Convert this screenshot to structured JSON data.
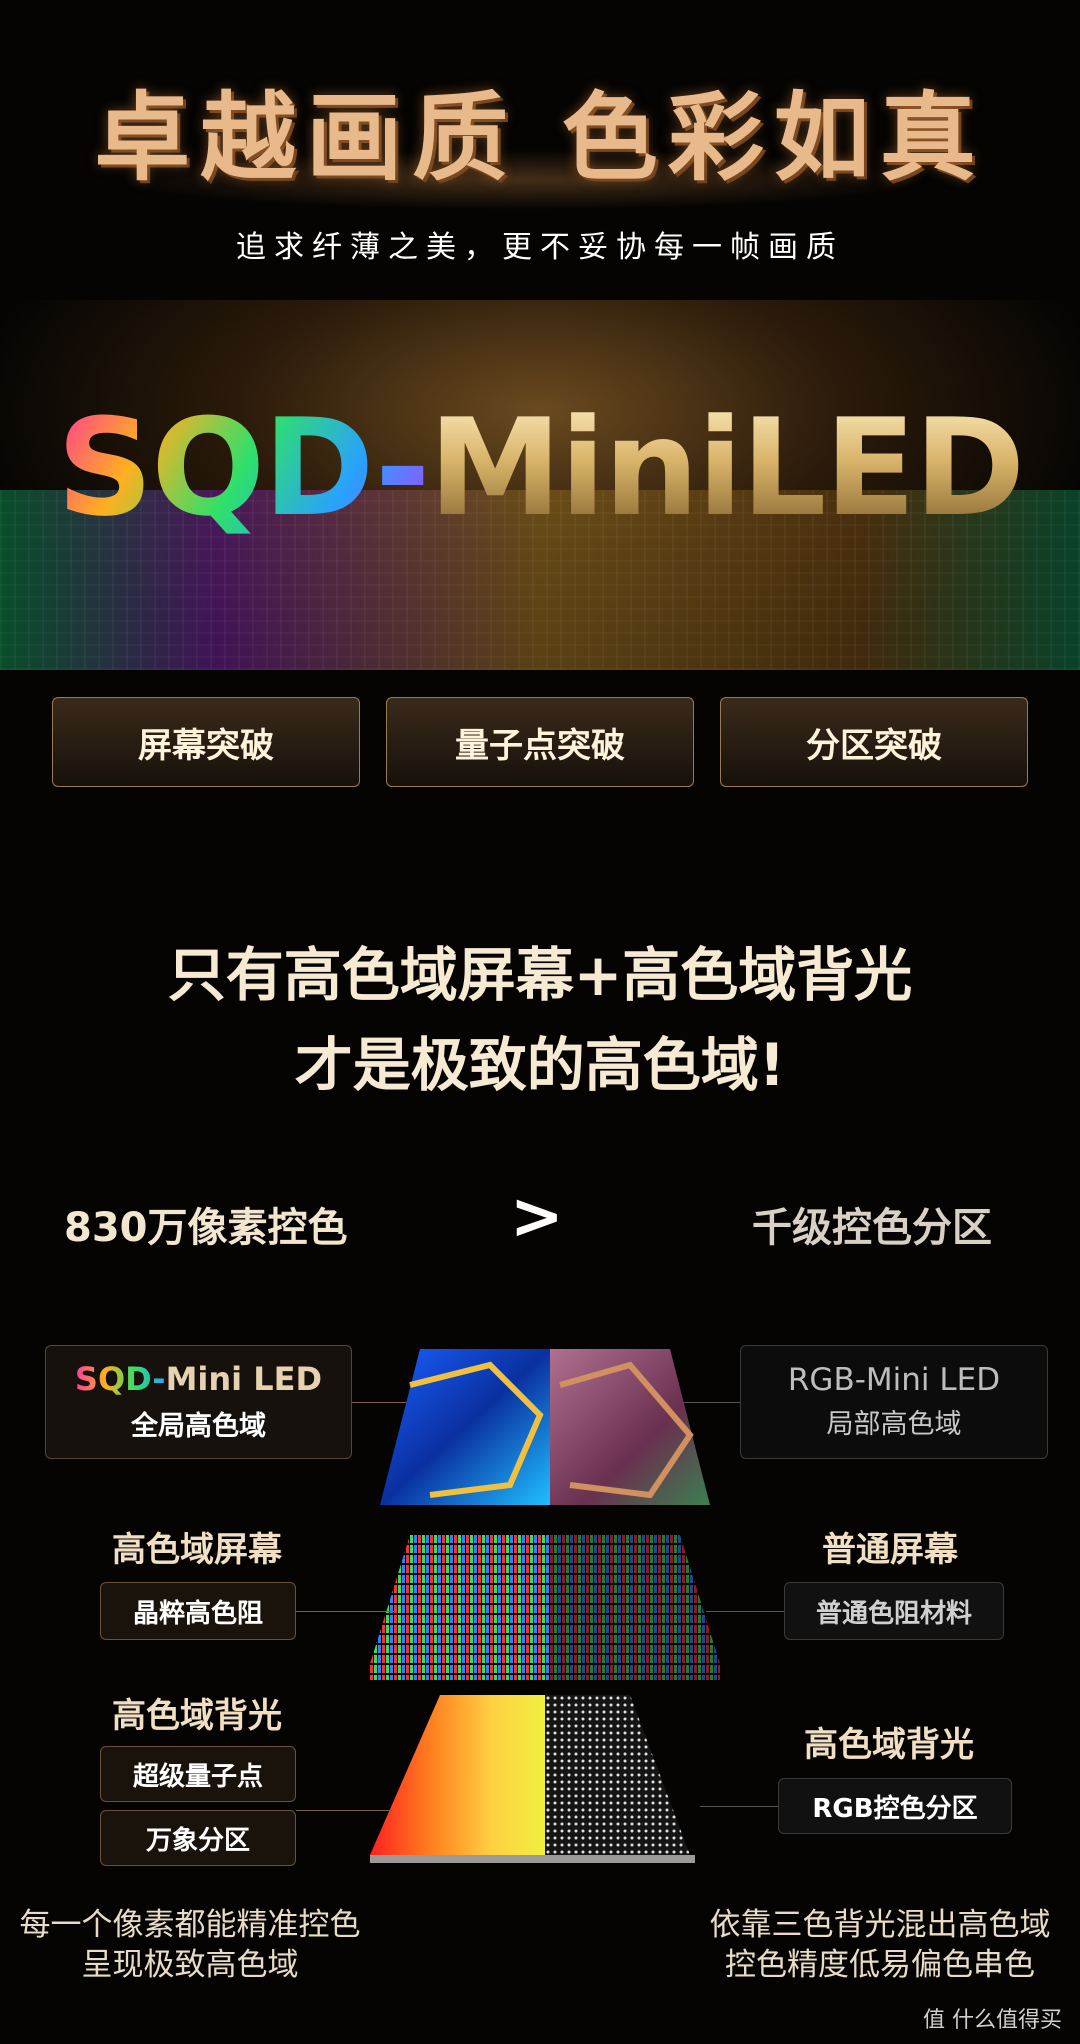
{
  "header": {
    "headline": "卓越画质 色彩如真",
    "subheadline": "追求纤薄之美，更不妥协每一帧画质"
  },
  "hero": {
    "logo_colored": "SQD-",
    "logo_gold": "MiniLED"
  },
  "tabs": [
    {
      "label": "屏幕突破"
    },
    {
      "label": "量子点突破"
    },
    {
      "label": "分区突破"
    }
  ],
  "slogan": {
    "line1": "只有高色域屏幕+高色域背光",
    "line2": "才是极致的高色域!"
  },
  "compare": {
    "left": "830万像素控色",
    "symbol": ">",
    "right": "千级控色分区"
  },
  "left_panel": {
    "brand_colored": "SQD-",
    "brand_rest": "Mini LED",
    "brand_sub": "全局高色域",
    "screen_title": "高色域屏幕",
    "screen_chip": "晶粹高色阻",
    "backlight_title": "高色域背光",
    "backlight_chip1": "超级量子点",
    "backlight_chip2": "万象分区",
    "footer_line1": "每一个像素都能精准控色",
    "footer_line2": "呈现极致高色域"
  },
  "right_panel": {
    "brand": "RGB-Mini LED",
    "brand_sub": "局部高色域",
    "screen_title": "普通屏幕",
    "screen_chip": "普通色阻材料",
    "backlight_title": "高色域背光",
    "backlight_chip": "RGB控色分区",
    "footer_line1": "依靠三色背光混出高色域",
    "footer_line2": "控色精度低易偏色串色"
  },
  "watermark": "值 什么值得买"
}
